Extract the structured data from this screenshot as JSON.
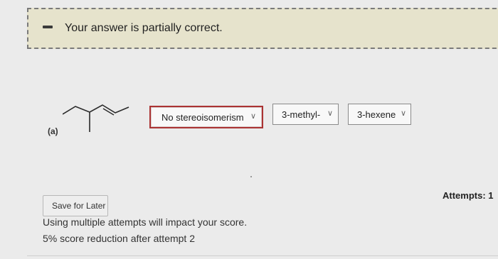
{
  "banner": {
    "message": "Your answer is partially correct."
  },
  "question": {
    "part_label": "(a)"
  },
  "dropdowns": {
    "stereo": {
      "value": "No stereoisomerism",
      "status": "incorrect"
    },
    "prefix": {
      "value": "3-methyl-"
    },
    "parent": {
      "value": "3-hexene"
    }
  },
  "footer": {
    "attempts_label": "Attempts: 1",
    "save_label": "Save for Later",
    "note_line1": "Using multiple attempts will impact your score.",
    "note_line2": "5% score reduction after attempt 2"
  },
  "colors": {
    "banner_bg": "#e6e3cc",
    "incorrect_border": "#aa3333"
  }
}
